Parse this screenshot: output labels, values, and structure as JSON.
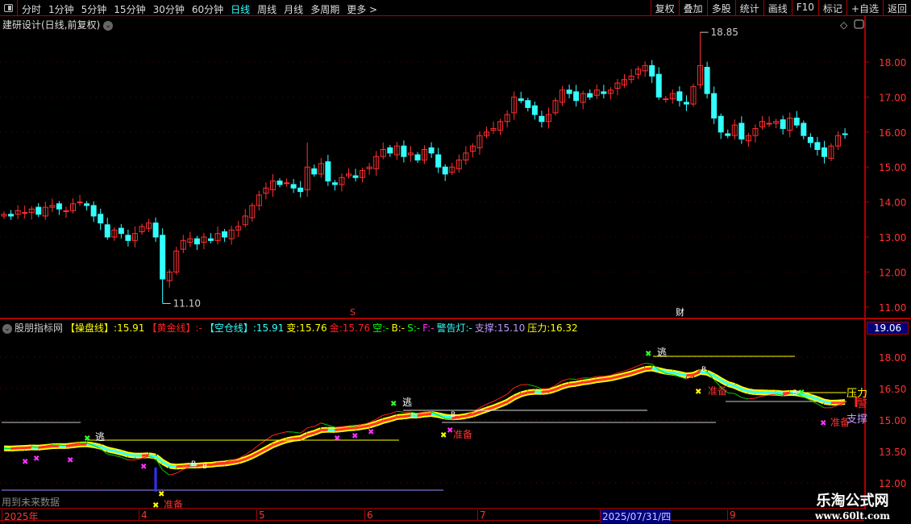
{
  "toolbar": {
    "periods": [
      "分时",
      "1分钟",
      "5分钟",
      "15分钟",
      "30分钟",
      "60分钟",
      "日线",
      "周线",
      "月线",
      "多周期",
      "更多 >"
    ],
    "active": "日线",
    "buttons": [
      "复权",
      "叠加",
      "多股",
      "统计",
      "画线",
      "F10",
      "标记",
      "+自选",
      "返回"
    ]
  },
  "title": "建研设计(日线,前复权)",
  "indicator": {
    "name": "股朋指标网",
    "items": [
      {
        "label": "【操盘线】",
        "value": ":15.91",
        "color": "#ffff00",
        "vcolor": "#ffff00"
      },
      {
        "label": "【黄金线】",
        "value": ":-",
        "color": "#ff2020",
        "vcolor": "#ff2020"
      },
      {
        "label": "【空仓线】",
        "value": ":15.91",
        "color": "#33ffff",
        "vcolor": "#33ffff"
      },
      {
        "label": "变",
        "value": ":15.76",
        "color": "#ffff00",
        "vcolor": "#ffff00"
      },
      {
        "label": "金",
        "value": ":15.76",
        "color": "#ff2020",
        "vcolor": "#ff2020"
      },
      {
        "label": "空",
        "value": ":-",
        "color": "#00ff00",
        "vcolor": "#00ff00"
      },
      {
        "label": "B",
        "value": ":-",
        "color": "#ffff00",
        "vcolor": "#ffff00"
      },
      {
        "label": "S",
        "value": ":-",
        "color": "#00ff00",
        "vcolor": "#00ff00"
      },
      {
        "label": "F",
        "value": ":-",
        "color": "#ff33ff",
        "vcolor": "#ff33ff"
      },
      {
        "label": "警告灯",
        "value": ":-",
        "color": "#33ffff",
        "vcolor": "#33ffff"
      },
      {
        "label": "支撑",
        "value": ":15.10",
        "color": "#bb99ff",
        "vcolor": "#bb99ff"
      },
      {
        "label": "压力",
        "value": ":16.32",
        "color": "#ffff00",
        "vcolor": "#ffff00"
      }
    ]
  },
  "lower_top_value": "19.06",
  "future_note": "用到未来数据",
  "labels": {
    "escape": "逃",
    "prepare": "准备",
    "pressure": "压力",
    "support": "支撑",
    "warn": "警",
    "cai": "财",
    "s": "S"
  },
  "dates": [
    "2025年",
    "4",
    "5",
    "6",
    "7",
    "2025/07/31/四",
    "9"
  ],
  "watermark": {
    "name": "乐淘公式网",
    "url": "www.60lt.com"
  },
  "chart_data": {
    "type": "candlestick",
    "yticks": [
      "18.00",
      "17.00",
      "16.00",
      "15.00",
      "14.00",
      "13.00",
      "12.00",
      "11.00"
    ],
    "lower_yticks": [
      "18.00",
      "16.50",
      "15.00",
      "13.50",
      "12.00"
    ],
    "max_label": "18.85",
    "min_label": "11.10",
    "max": 18.85,
    "min": 11.1,
    "closes": [
      13.65,
      13.6,
      13.75,
      13.7,
      13.8,
      13.65,
      13.85,
      13.9,
      13.8,
      13.75,
      13.95,
      14.0,
      13.9,
      13.6,
      13.4,
      13.0,
      13.2,
      13.1,
      12.9,
      13.1,
      13.3,
      13.4,
      13.0,
      11.8,
      12.0,
      12.6,
      12.9,
      12.95,
      12.8,
      13.0,
      12.9,
      13.1,
      13.0,
      13.2,
      13.3,
      13.6,
      13.9,
      14.2,
      14.4,
      14.6,
      14.5,
      14.55,
      14.4,
      14.3,
      15.0,
      14.8,
      15.1,
      14.6,
      14.5,
      14.7,
      14.8,
      14.7,
      14.9,
      15.0,
      15.3,
      15.5,
      15.4,
      15.6,
      15.3,
      15.4,
      15.2,
      15.5,
      15.4,
      15.0,
      14.8,
      15.0,
      15.2,
      15.4,
      15.6,
      15.9,
      16.0,
      16.1,
      16.3,
      16.5,
      17.0,
      16.9,
      16.7,
      16.5,
      16.3,
      16.5,
      16.9,
      17.2,
      17.1,
      16.9,
      17.1,
      17.0,
      17.2,
      17.1,
      17.2,
      17.4,
      17.5,
      17.6,
      17.8,
      17.9,
      17.6,
      17.0,
      16.95,
      17.1,
      16.9,
      16.8,
      17.3,
      17.9,
      17.1,
      16.4,
      16.0,
      15.9,
      16.2,
      15.8,
      15.9,
      16.1,
      16.3,
      16.25,
      16.3,
      16.1,
      16.4,
      16.2,
      15.9,
      15.7,
      15.5,
      15.3,
      15.6,
      15.9,
      15.95
    ],
    "pressure": 16.32,
    "support": 15.1
  }
}
